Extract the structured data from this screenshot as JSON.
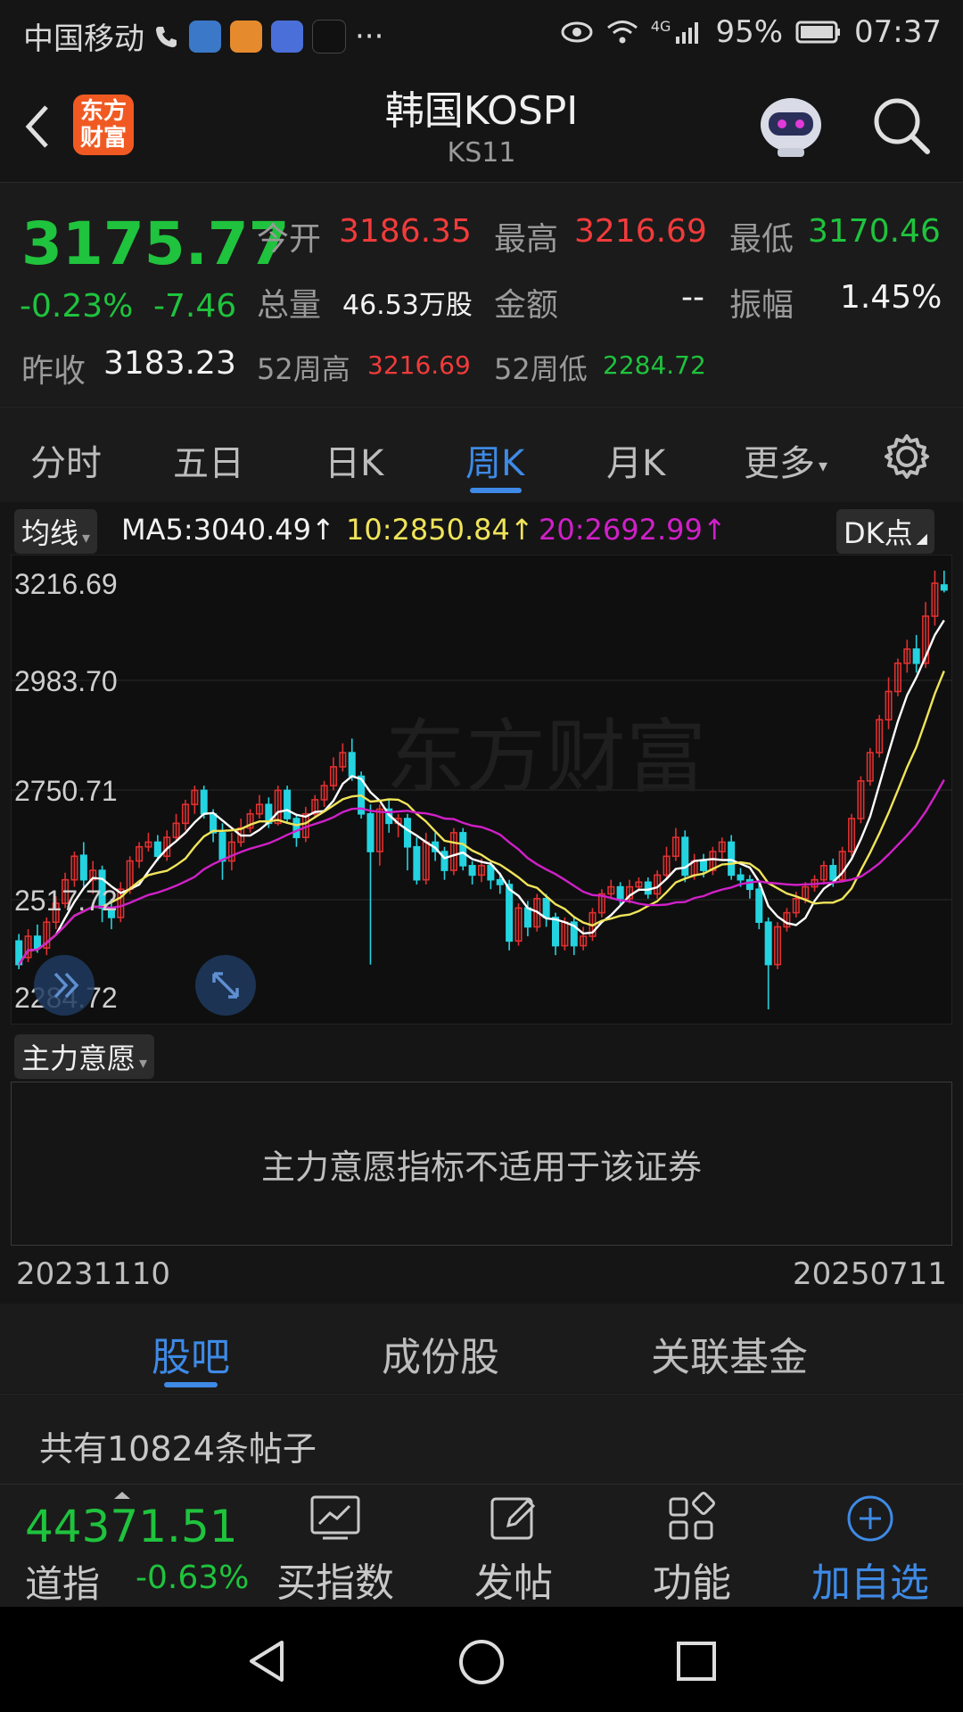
{
  "status_bar": {
    "carrier": "中国移动",
    "more": "···",
    "network": "4G",
    "battery": "95%",
    "time": "07:37"
  },
  "header": {
    "logo_text": "东方财富",
    "title": "韩国KOSPI",
    "code": "KS11"
  },
  "quote": {
    "price": "3175.77",
    "change_pct": "-0.23%",
    "change": "-7.46",
    "prev_close_label": "昨收",
    "prev_close": "3183.23",
    "open_label": "今开",
    "open": "3186.35",
    "high_label": "最高",
    "high": "3216.69",
    "low_label": "最低",
    "low": "3170.46",
    "volume_label": "总量",
    "volume": "46.53万股",
    "amount_label": "金额",
    "amount": "--",
    "amplitude_label": "振幅",
    "amplitude": "1.45%",
    "wk52_high_label": "52周高",
    "wk52_high": "3216.69",
    "wk52_low_label": "52周低",
    "wk52_low": "2284.72"
  },
  "period_tabs": [
    "分时",
    "五日",
    "日K",
    "周K",
    "月K",
    "更多"
  ],
  "active_period": "周K",
  "ma_bar": {
    "selector": "均线",
    "ma5": "MA5:3040.49",
    "ma10": "10:2850.84",
    "ma20": "20:2692.99",
    "dk": "DK点"
  },
  "colors": {
    "up": "#f23b3b",
    "down": "#1fc33d",
    "accent": "#3e8ae6",
    "ma5": "#ffffff",
    "ma10": "#f0e45a",
    "ma20": "#d020c8",
    "candle_up": "#e03030",
    "candle_down": "#24d3e0"
  },
  "chart_data": {
    "type": "candlestick",
    "y_tick_labels": [
      "3216.69",
      "2983.70",
      "2750.71",
      "2517.72",
      "2284.72"
    ],
    "ylim": [
      2284.72,
      3216.69
    ],
    "x_start_label": "20231110",
    "x_end_label": "20250711",
    "candles": [
      {
        "o": 2430,
        "c": 2380,
        "h": 2445,
        "l": 2370
      },
      {
        "o": 2395,
        "c": 2440,
        "h": 2455,
        "l": 2385
      },
      {
        "o": 2440,
        "c": 2415,
        "h": 2465,
        "l": 2405
      },
      {
        "o": 2415,
        "c": 2470,
        "h": 2480,
        "l": 2400
      },
      {
        "o": 2470,
        "c": 2510,
        "h": 2525,
        "l": 2455
      },
      {
        "o": 2510,
        "c": 2560,
        "h": 2575,
        "l": 2500
      },
      {
        "o": 2560,
        "c": 2610,
        "h": 2620,
        "l": 2545
      },
      {
        "o": 2612,
        "c": 2560,
        "h": 2640,
        "l": 2545
      },
      {
        "o": 2560,
        "c": 2580,
        "h": 2600,
        "l": 2530
      },
      {
        "o": 2580,
        "c": 2500,
        "h": 2590,
        "l": 2470
      },
      {
        "o": 2500,
        "c": 2480,
        "h": 2520,
        "l": 2455
      },
      {
        "o": 2480,
        "c": 2540,
        "h": 2555,
        "l": 2470
      },
      {
        "o": 2540,
        "c": 2600,
        "h": 2610,
        "l": 2530
      },
      {
        "o": 2600,
        "c": 2630,
        "h": 2640,
        "l": 2585
      },
      {
        "o": 2630,
        "c": 2640,
        "h": 2660,
        "l": 2620
      },
      {
        "o": 2640,
        "c": 2610,
        "h": 2655,
        "l": 2600
      },
      {
        "o": 2610,
        "c": 2650,
        "h": 2665,
        "l": 2600
      },
      {
        "o": 2650,
        "c": 2680,
        "h": 2700,
        "l": 2640
      },
      {
        "o": 2680,
        "c": 2720,
        "h": 2730,
        "l": 2665
      },
      {
        "o": 2720,
        "c": 2750,
        "h": 2760,
        "l": 2700
      },
      {
        "o": 2750,
        "c": 2700,
        "h": 2760,
        "l": 2690
      },
      {
        "o": 2700,
        "c": 2660,
        "h": 2710,
        "l": 2640
      },
      {
        "o": 2660,
        "c": 2600,
        "h": 2680,
        "l": 2560
      },
      {
        "o": 2600,
        "c": 2640,
        "h": 2660,
        "l": 2580
      },
      {
        "o": 2640,
        "c": 2670,
        "h": 2690,
        "l": 2630
      },
      {
        "o": 2670,
        "c": 2700,
        "h": 2710,
        "l": 2660
      },
      {
        "o": 2700,
        "c": 2720,
        "h": 2740,
        "l": 2690
      },
      {
        "o": 2720,
        "c": 2680,
        "h": 2735,
        "l": 2670
      },
      {
        "o": 2680,
        "c": 2750,
        "h": 2760,
        "l": 2675
      },
      {
        "o": 2750,
        "c": 2690,
        "h": 2760,
        "l": 2680
      },
      {
        "o": 2690,
        "c": 2650,
        "h": 2700,
        "l": 2630
      },
      {
        "o": 2650,
        "c": 2700,
        "h": 2715,
        "l": 2640
      },
      {
        "o": 2700,
        "c": 2730,
        "h": 2740,
        "l": 2690
      },
      {
        "o": 2730,
        "c": 2760,
        "h": 2770,
        "l": 2715
      },
      {
        "o": 2760,
        "c": 2800,
        "h": 2820,
        "l": 2750
      },
      {
        "o": 2800,
        "c": 2830,
        "h": 2850,
        "l": 2790
      },
      {
        "o": 2830,
        "c": 2780,
        "h": 2860,
        "l": 2770
      },
      {
        "o": 2780,
        "c": 2700,
        "h": 2790,
        "l": 2690
      },
      {
        "o": 2700,
        "c": 2620,
        "h": 2720,
        "l": 2380
      },
      {
        "o": 2620,
        "c": 2710,
        "h": 2720,
        "l": 2590
      },
      {
        "o": 2710,
        "c": 2680,
        "h": 2730,
        "l": 2660
      },
      {
        "o": 2680,
        "c": 2690,
        "h": 2700,
        "l": 2650
      },
      {
        "o": 2690,
        "c": 2630,
        "h": 2700,
        "l": 2580
      },
      {
        "o": 2630,
        "c": 2560,
        "h": 2650,
        "l": 2550
      },
      {
        "o": 2560,
        "c": 2640,
        "h": 2660,
        "l": 2550
      },
      {
        "o": 2640,
        "c": 2620,
        "h": 2660,
        "l": 2600
      },
      {
        "o": 2620,
        "c": 2580,
        "h": 2630,
        "l": 2560
      },
      {
        "o": 2580,
        "c": 2660,
        "h": 2670,
        "l": 2570
      },
      {
        "o": 2660,
        "c": 2590,
        "h": 2670,
        "l": 2580
      },
      {
        "o": 2590,
        "c": 2570,
        "h": 2600,
        "l": 2550
      },
      {
        "o": 2570,
        "c": 2590,
        "h": 2605,
        "l": 2555
      },
      {
        "o": 2590,
        "c": 2560,
        "h": 2600,
        "l": 2540
      },
      {
        "o": 2560,
        "c": 2550,
        "h": 2575,
        "l": 2530
      },
      {
        "o": 2550,
        "c": 2430,
        "h": 2560,
        "l": 2410
      },
      {
        "o": 2430,
        "c": 2500,
        "h": 2510,
        "l": 2420
      },
      {
        "o": 2500,
        "c": 2460,
        "h": 2515,
        "l": 2440
      },
      {
        "o": 2460,
        "c": 2520,
        "h": 2530,
        "l": 2450
      },
      {
        "o": 2520,
        "c": 2480,
        "h": 2530,
        "l": 2460
      },
      {
        "o": 2480,
        "c": 2420,
        "h": 2490,
        "l": 2400
      },
      {
        "o": 2420,
        "c": 2470,
        "h": 2480,
        "l": 2410
      },
      {
        "o": 2470,
        "c": 2420,
        "h": 2480,
        "l": 2400
      },
      {
        "o": 2420,
        "c": 2440,
        "h": 2460,
        "l": 2410
      },
      {
        "o": 2440,
        "c": 2490,
        "h": 2500,
        "l": 2430
      },
      {
        "o": 2490,
        "c": 2530,
        "h": 2540,
        "l": 2480
      },
      {
        "o": 2530,
        "c": 2545,
        "h": 2560,
        "l": 2520
      },
      {
        "o": 2545,
        "c": 2520,
        "h": 2555,
        "l": 2505
      },
      {
        "o": 2520,
        "c": 2545,
        "h": 2560,
        "l": 2510
      },
      {
        "o": 2545,
        "c": 2555,
        "h": 2565,
        "l": 2535
      },
      {
        "o": 2555,
        "c": 2530,
        "h": 2565,
        "l": 2520
      },
      {
        "o": 2530,
        "c": 2570,
        "h": 2580,
        "l": 2520
      },
      {
        "o": 2570,
        "c": 2610,
        "h": 2630,
        "l": 2560
      },
      {
        "o": 2610,
        "c": 2650,
        "h": 2670,
        "l": 2600
      },
      {
        "o": 2650,
        "c": 2570,
        "h": 2665,
        "l": 2555
      },
      {
        "o": 2570,
        "c": 2600,
        "h": 2615,
        "l": 2560
      },
      {
        "o": 2600,
        "c": 2580,
        "h": 2615,
        "l": 2565
      },
      {
        "o": 2580,
        "c": 2620,
        "h": 2630,
        "l": 2570
      },
      {
        "o": 2620,
        "c": 2640,
        "h": 2650,
        "l": 2605
      },
      {
        "o": 2640,
        "c": 2570,
        "h": 2655,
        "l": 2560
      },
      {
        "o": 2570,
        "c": 2560,
        "h": 2585,
        "l": 2545
      },
      {
        "o": 2560,
        "c": 2540,
        "h": 2570,
        "l": 2520
      },
      {
        "o": 2540,
        "c": 2470,
        "h": 2555,
        "l": 2455
      },
      {
        "o": 2470,
        "c": 2380,
        "h": 2480,
        "l": 2284.72
      },
      {
        "o": 2380,
        "c": 2460,
        "h": 2470,
        "l": 2370
      },
      {
        "o": 2460,
        "c": 2490,
        "h": 2500,
        "l": 2450
      },
      {
        "o": 2490,
        "c": 2520,
        "h": 2535,
        "l": 2480
      },
      {
        "o": 2520,
        "c": 2545,
        "h": 2555,
        "l": 2510
      },
      {
        "o": 2545,
        "c": 2560,
        "h": 2570,
        "l": 2535
      },
      {
        "o": 2560,
        "c": 2590,
        "h": 2600,
        "l": 2550
      },
      {
        "o": 2590,
        "c": 2560,
        "h": 2605,
        "l": 2545
      },
      {
        "o": 2560,
        "c": 2620,
        "h": 2630,
        "l": 2555
      },
      {
        "o": 2620,
        "c": 2690,
        "h": 2700,
        "l": 2610
      },
      {
        "o": 2690,
        "c": 2770,
        "h": 2780,
        "l": 2680
      },
      {
        "o": 2770,
        "c": 2830,
        "h": 2840,
        "l": 2760
      },
      {
        "o": 2830,
        "c": 2900,
        "h": 2910,
        "l": 2820
      },
      {
        "o": 2900,
        "c": 2960,
        "h": 2990,
        "l": 2880
      },
      {
        "o": 2960,
        "c": 3020,
        "h": 3030,
        "l": 2950
      },
      {
        "o": 3020,
        "c": 3050,
        "h": 3070,
        "l": 3000
      },
      {
        "o": 3050,
        "c": 3020,
        "h": 3080,
        "l": 3000
      },
      {
        "o": 3020,
        "c": 3120,
        "h": 3150,
        "l": 3010
      },
      {
        "o": 3120,
        "c": 3190,
        "h": 3216.69,
        "l": 3100
      },
      {
        "o": 3186.35,
        "c": 3175.77,
        "h": 3216.69,
        "l": 3170.46
      }
    ]
  },
  "watermark": "东方财富",
  "indicator": {
    "selector": "主力意愿",
    "message": "主力意愿指标不适用于该证券"
  },
  "bottom_tabs": [
    "股吧",
    "成份股",
    "关联基金"
  ],
  "posts_count_text": "共有10824条帖子",
  "toolbar": {
    "index_value": "44371.51",
    "index_name": "道指",
    "index_change": "-0.63%",
    "buy_index": "买指数",
    "post": "发帖",
    "functions": "功能",
    "add_watch": "加自选"
  }
}
